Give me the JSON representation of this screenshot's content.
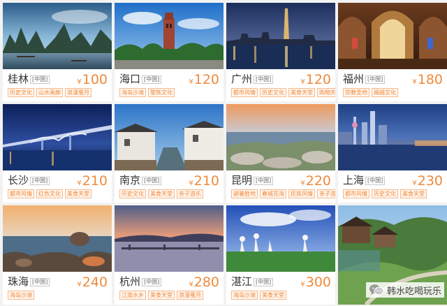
{
  "cards": [
    {
      "city": "桂林",
      "country": "[中国]",
      "price": "100",
      "tags": [
        "历史文化",
        "山水画廊",
        "浪漫蜜月"
      ],
      "scene": "guilin"
    },
    {
      "city": "海口",
      "country": "[中国]",
      "price": "120",
      "tags": [
        "海岛沙滩",
        "黎族文化"
      ],
      "scene": "haikou"
    },
    {
      "city": "广州",
      "country": "[中国]",
      "price": "120",
      "tags": [
        "都市风情",
        "历史文化",
        "美食天堂",
        "购物天堂"
      ],
      "scene": "guangzhou"
    },
    {
      "city": "福州",
      "country": "[中国]",
      "price": "180",
      "tags": [
        "宗教圣地",
        "闽越文化"
      ],
      "scene": "fuzhou"
    },
    {
      "city": "长沙",
      "country": "[中国]",
      "price": "210",
      "tags": [
        "都市风情",
        "红色文化",
        "美食天堂"
      ],
      "scene": "changsha"
    },
    {
      "city": "南京",
      "country": "[中国]",
      "price": "210",
      "tags": [
        "历史文化",
        "美食天堂",
        "亲子游乐"
      ],
      "scene": "nanjing"
    },
    {
      "city": "昆明",
      "country": "[中国]",
      "price": "220",
      "tags": [
        "避暑胜地",
        "春城花海",
        "民族风情",
        "亲子游乐"
      ],
      "scene": "kunming"
    },
    {
      "city": "上海",
      "country": "[中国]",
      "price": "230",
      "tags": [
        "都市风情",
        "历史文化",
        "美食天堂"
      ],
      "scene": "shanghai"
    },
    {
      "city": "珠海",
      "country": "[中国]",
      "price": "240",
      "tags": [
        "海岛沙滩"
      ],
      "scene": "zhuhai"
    },
    {
      "city": "杭州",
      "country": "[中国]",
      "price": "280",
      "tags": [
        "江南水乡",
        "美食天堂",
        "浪漫蜜月"
      ],
      "scene": "hangzhou"
    },
    {
      "city": "湛江",
      "country": "[中国]",
      "price": "300",
      "tags": [
        "海岛沙滩",
        "美食天堂"
      ],
      "scene": "zhanjiang"
    },
    {
      "city": "",
      "country": "",
      "price": "",
      "tags": [],
      "scene": "village"
    }
  ],
  "currency_symbol": "¥",
  "watermark": {
    "text": "韩水吃喝玩乐",
    "icon": "wechat-icon"
  },
  "colors": {
    "accent": "#f08a3a",
    "tag_border": "#f6b98a",
    "tag_bg": "#fff5ee",
    "page_bg": "#f2f2f2"
  }
}
